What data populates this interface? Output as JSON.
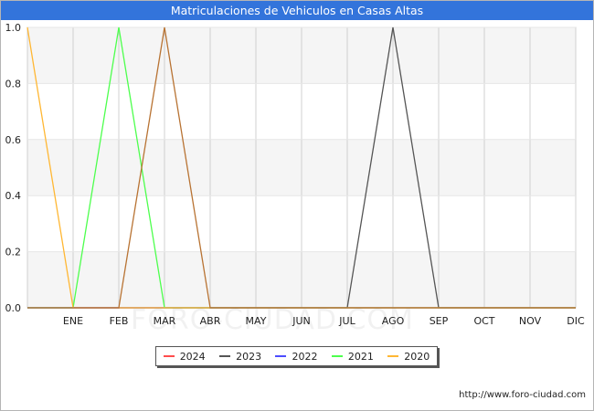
{
  "title": "Matriculaciones de Vehiculos en Casas Altas",
  "watermark": "FORO-CIUDAD.COM",
  "source": "http://www.foro-ciudad.com",
  "chart_data": {
    "type": "line",
    "title": "Matriculaciones de Vehiculos en Casas Altas",
    "x": [
      "",
      "ENE",
      "FEB",
      "MAR",
      "ABR",
      "MAY",
      "JUN",
      "JUL",
      "AGO",
      "SEP",
      "OCT",
      "NOV",
      "DIC"
    ],
    "ylim": [
      0,
      1.0
    ],
    "yticks": [
      "0.0",
      "0.2",
      "0.4",
      "0.6",
      "0.8",
      "1.0"
    ],
    "grid": true,
    "legend_position": "bottom",
    "series": [
      {
        "name": "2024",
        "color": "#ff4d4d",
        "values": [
          0,
          0,
          0,
          0,
          0,
          0,
          0,
          0,
          0,
          0,
          0,
          0,
          0
        ]
      },
      {
        "name": "2023",
        "color": "#555555",
        "values": [
          0,
          0,
          0,
          0,
          0,
          0,
          0,
          0,
          1,
          0,
          0,
          0,
          0
        ]
      },
      {
        "name": "2022",
        "color": "#4d4dff",
        "values": [
          0,
          0,
          0,
          0,
          0,
          0,
          0,
          0,
          0,
          0,
          0,
          0,
          0
        ]
      },
      {
        "name": "2021",
        "color": "#4dff4d",
        "values": [
          0,
          0,
          1,
          0,
          0,
          0,
          0,
          0,
          0,
          0,
          0,
          0,
          0
        ]
      },
      {
        "name": "2020",
        "color": "#ffb733",
        "values": [
          1,
          0,
          0,
          0,
          0,
          0,
          0,
          0,
          0,
          0,
          0,
          0,
          0
        ]
      },
      {
        "name": "",
        "color": "#b87333",
        "values": [
          0,
          0,
          0,
          1,
          0,
          0,
          0,
          0,
          0,
          0,
          0,
          0,
          0
        ]
      }
    ]
  }
}
